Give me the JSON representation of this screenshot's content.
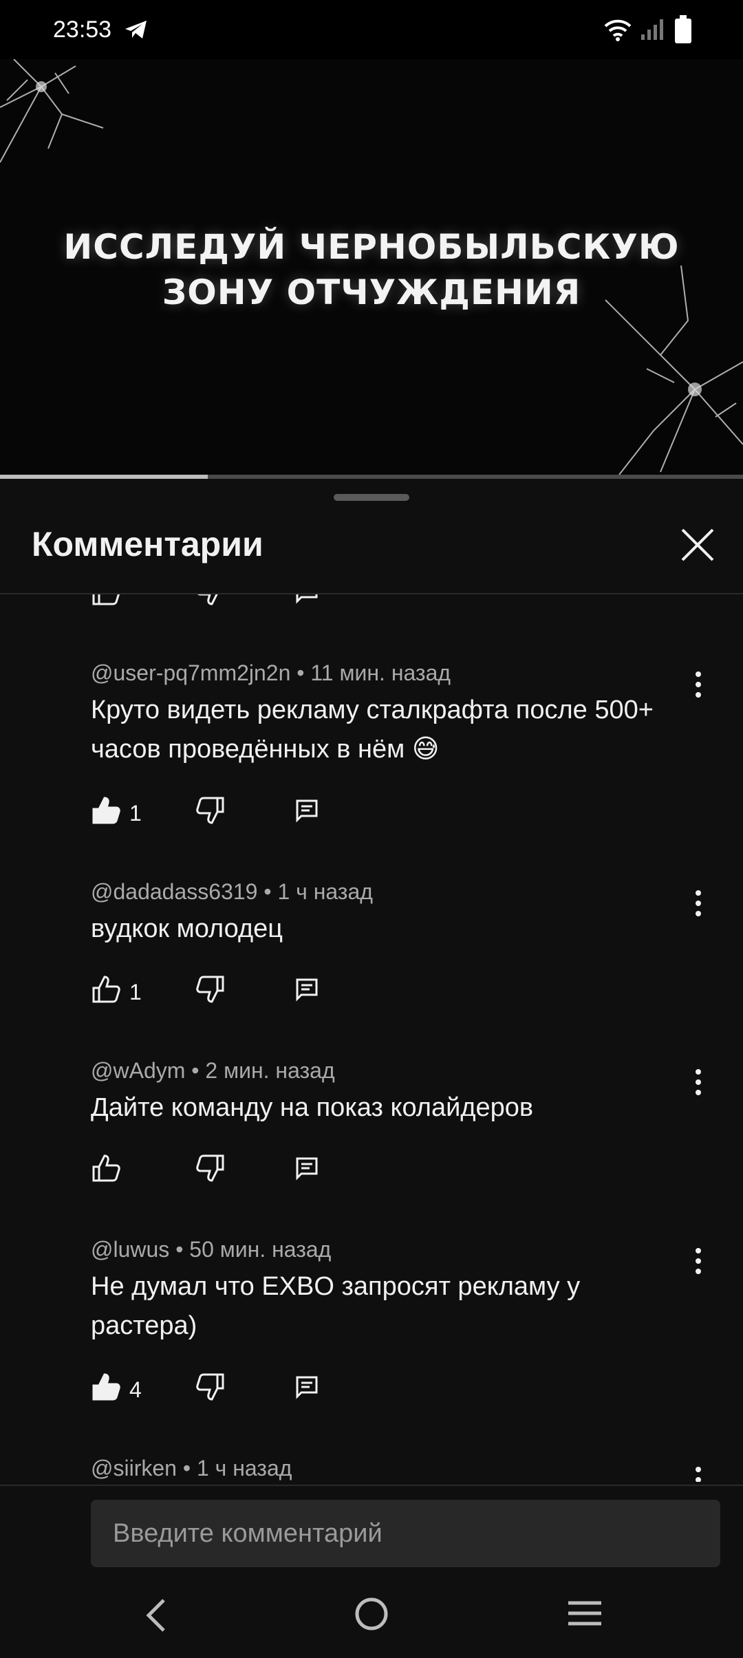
{
  "status_bar": {
    "time": "23:53"
  },
  "video": {
    "title_line1": "ИССЛЕДУЙ ЧЕРНОБЫЛЬСКУЮ",
    "title_line2": "ЗОНУ ОТЧУЖДЕНИЯ",
    "progress": 0.28
  },
  "panel": {
    "title": "Комментарии"
  },
  "comments": [
    {
      "author": "@user-pq7mm2jn2n",
      "time": "11 мин. назад",
      "text": "Круто видеть рекламу сталкрафта после 500+ часов проведённых в нём 😅",
      "likes": "1",
      "liked": true
    },
    {
      "author": "@dadadass6319",
      "time": "1 ч назад",
      "text": "вудкок молодец",
      "likes": "1",
      "liked": false
    },
    {
      "author": "@wAdym",
      "time": "2 мин. назад",
      "text": "Дайте команду на показ колайдеров",
      "likes": "",
      "liked": false
    },
    {
      "author": "@luwus",
      "time": "50 мин. назад",
      "text": "Не думал что EXBO запросят рекламу у растера)",
      "likes": "4",
      "liked": true
    },
    {
      "author": "@siirken",
      "time": "1 ч назад",
      "text": "",
      "likes": "",
      "liked": false
    }
  ],
  "input": {
    "placeholder": "Введите комментарий"
  }
}
